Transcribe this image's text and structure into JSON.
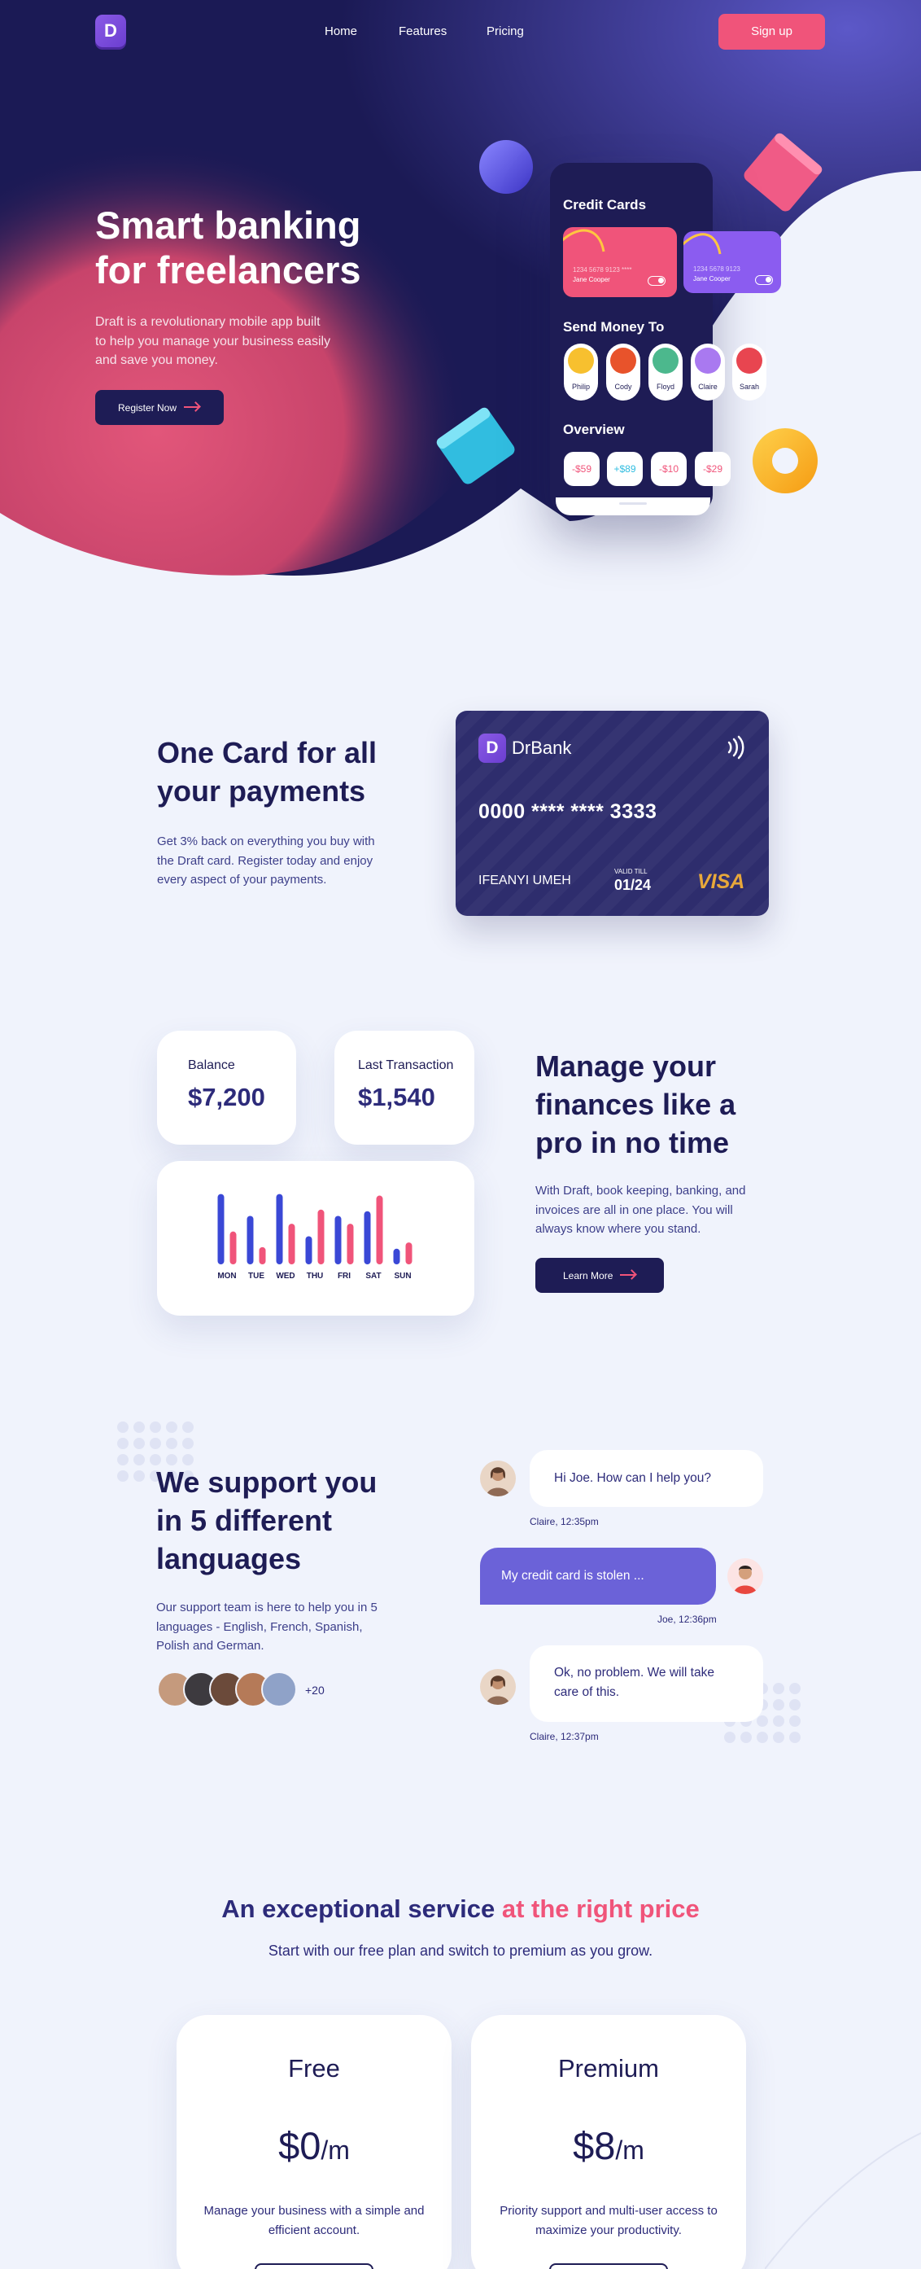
{
  "nav": {
    "logo_letter": "D",
    "links": [
      "Home",
      "Features",
      "Pricing"
    ],
    "signup": "Sign up"
  },
  "hero": {
    "title": "Smart banking for freelancers",
    "subtitle": "Draft is a revolutionary mobile app built to help you manage your business easily and save you money.",
    "cta": "Register Now"
  },
  "phone": {
    "credit_cards_title": "Credit Cards",
    "cards": [
      {
        "number": "1234 5678 9123 ****",
        "name": "Jane Cooper"
      },
      {
        "number": "1234 5678 9123",
        "name": "Jane Cooper"
      }
    ],
    "send_title": "Send Money To",
    "contacts": [
      "Philip",
      "Cody",
      "Floyd",
      "Claire",
      "Sarah"
    ],
    "overview_title": "Overview",
    "overview": [
      "-$59",
      "+$89",
      "-$10",
      "-$29"
    ]
  },
  "one_card": {
    "title": "One Card for all your payments",
    "body": "Get 3% back on everything you buy with the Draft card. Register today and enjoy every aspect of your payments.",
    "card": {
      "brand": "DrBank",
      "logo_letter": "D",
      "number": "0000 **** **** 3333",
      "holder": "IFEANYI UMEH",
      "valid_label": "VALID TILL",
      "valid": "01/24",
      "network": "VISA"
    }
  },
  "manage": {
    "balance_label": "Balance",
    "balance": "$7,200",
    "last_label": "Last Transaction",
    "last": "$1,540",
    "title": "Manage your finances like a pro in no time",
    "body": "With Draft, book keeping, banking, and invoices are all in one place. You will always know where you stand.",
    "cta": "Learn More"
  },
  "chart_data": {
    "type": "bar",
    "categories": [
      "MON",
      "TUE",
      "WED",
      "THU",
      "FRI",
      "SAT",
      "SUN"
    ],
    "series": [
      {
        "values": [
          90,
          62,
          90,
          36,
          62,
          68,
          20
        ]
      },
      {
        "values": [
          42,
          22,
          52,
          70,
          52,
          88,
          28
        ]
      }
    ],
    "ylim": [
      0,
      100
    ],
    "colors": [
      "#3a48d6",
      "#f0547a"
    ]
  },
  "support": {
    "title": "We support you in 5 different languages",
    "body": "Our support team is here to help you in 5 languages - English, French, Spanish, Polish and German.",
    "more": "+20",
    "messages": [
      {
        "text": "Hi Joe. How can I help you?",
        "meta": "Claire, 12:35pm"
      },
      {
        "text": "My credit card is stolen ...",
        "meta": "Joe, 12:36pm"
      },
      {
        "text": "Ok, no problem. We will take care of this.",
        "meta": "Claire, 12:37pm"
      }
    ]
  },
  "pricing": {
    "title_a": "An exceptional service",
    "title_b": "at the right price",
    "subtitle": "Start with our free plan and switch to premium as you grow.",
    "plans": [
      {
        "name": "Free",
        "price": "$0",
        "per": "/m",
        "desc": "Manage your business with a simple and efficient account."
      },
      {
        "name": "Premium",
        "price": "$8",
        "per": "/m",
        "desc": "Priority support and multi-user access to maximize your productivity."
      }
    ]
  },
  "colors": {
    "navy": "#1e1c55",
    "pink": "#f0547a",
    "purple": "#6b5fd9",
    "page": "#f0f3fc"
  }
}
